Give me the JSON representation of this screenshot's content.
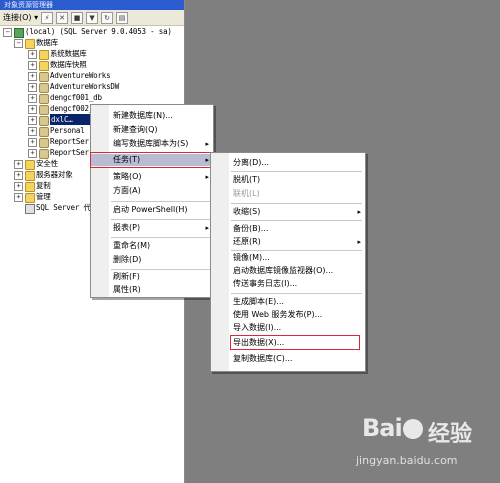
{
  "window": {
    "title": "对象资源管理器"
  },
  "toolbar": {
    "connect_label": "连接(O) ▾"
  },
  "tree": [
    {
      "label": "(local) (SQL Server 9.0.4053 - sa)",
      "icon": "server-icon",
      "pm": "−"
    },
    {
      "label": "数据库",
      "icon": "folder-icon",
      "pm": "−"
    },
    {
      "label": "系统数据库",
      "icon": "folder-icon",
      "pm": "+"
    },
    {
      "label": "数据库快照",
      "icon": "folder-icon",
      "pm": "+"
    },
    {
      "label": "AdventureWorks",
      "icon": "database-icon",
      "pm": "+"
    },
    {
      "label": "AdventureWorksDW",
      "icon": "database-icon",
      "pm": "+"
    },
    {
      "label": "dengcf001_db",
      "icon": "database-icon",
      "pm": "+"
    },
    {
      "label": "dengcf002_db",
      "icon": "database-icon",
      "pm": "+"
    },
    {
      "label": "dxlC…",
      "icon": "database-icon",
      "pm": "+"
    },
    {
      "label": "Personal",
      "icon": "database-icon",
      "pm": "+"
    },
    {
      "label": "ReportSer",
      "icon": "database-icon",
      "pm": "+"
    },
    {
      "label": "ReportSer",
      "icon": "database-icon",
      "pm": "+"
    },
    {
      "label": "安全性",
      "icon": "folder-icon",
      "pm": "+"
    },
    {
      "label": "服务器对象",
      "icon": "folder-icon",
      "pm": "+"
    },
    {
      "label": "复制",
      "icon": "folder-icon",
      "pm": "+"
    },
    {
      "label": "管理",
      "icon": "folder-icon",
      "pm": "+"
    },
    {
      "label": "SQL Server 代",
      "icon": "agent-icon",
      "pm": ""
    }
  ],
  "context_menu": [
    {
      "label": "新建数据库(N)...",
      "arrow": ""
    },
    {
      "label": "新建查询(Q)",
      "arrow": ""
    },
    {
      "label": "编写数据库脚本为(S)",
      "arrow": "▸"
    },
    {
      "label": "任务(T)",
      "arrow": "▸"
    },
    {
      "label": "策略(O)",
      "arrow": "▸"
    },
    {
      "label": "方面(A)",
      "arrow": ""
    },
    {
      "label": "启动 PowerShell(H)",
      "arrow": ""
    },
    {
      "label": "报表(P)",
      "arrow": "▸"
    },
    {
      "label": "重命名(M)",
      "arrow": ""
    },
    {
      "label": "删除(D)",
      "arrow": ""
    },
    {
      "label": "刷新(F)",
      "arrow": ""
    },
    {
      "label": "属性(R)",
      "arrow": ""
    }
  ],
  "tasks_menu": [
    {
      "label": "分离(D)...",
      "arrow": ""
    },
    {
      "label": "脱机(T)",
      "arrow": ""
    },
    {
      "label": "联机(L)",
      "arrow": ""
    },
    {
      "label": "收缩(S)",
      "arrow": "▸"
    },
    {
      "label": "备份(B)...",
      "arrow": ""
    },
    {
      "label": "还原(R)",
      "arrow": "▸"
    },
    {
      "label": "镜像(M)...",
      "arrow": ""
    },
    {
      "label": "启动数据库镜像监视器(O)...",
      "arrow": ""
    },
    {
      "label": "传送事务日志(I)...",
      "arrow": ""
    },
    {
      "label": "生成脚本(E)...",
      "arrow": ""
    },
    {
      "label": "使用 Web 服务发布(P)...",
      "arrow": ""
    },
    {
      "label": "导入数据(I)...",
      "arrow": ""
    },
    {
      "label": "导出数据(X)...",
      "arrow": ""
    },
    {
      "label": "复制数据库(C)...",
      "arrow": ""
    }
  ],
  "watermark": {
    "logo": "Bai",
    "logo2": "经验",
    "url": "jingyan.baidu.com"
  },
  "colors": {
    "highlight_box": "#d8283a",
    "active_item": "#b6bdd2",
    "selection": "#0a246a"
  }
}
